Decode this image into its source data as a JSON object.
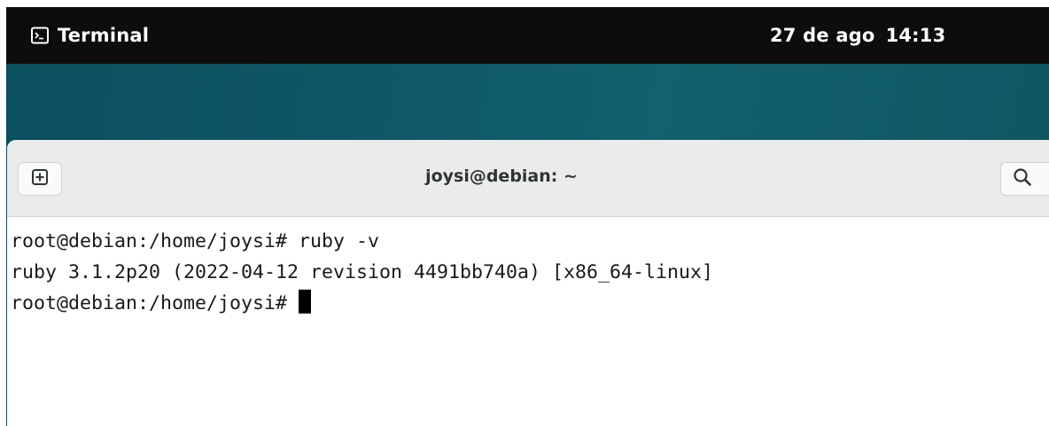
{
  "topbar": {
    "app_name": "Terminal",
    "app_icon": "terminal-icon",
    "date": "27 de ago",
    "time": "14:13"
  },
  "window": {
    "title": "joysi@debian: ~",
    "new_tab_icon": "new-tab-icon",
    "search_icon": "search-icon"
  },
  "terminal": {
    "lines": [
      "root@debian:/home/joysi# ruby -v",
      "ruby 3.1.2p20 (2022-04-12 revision 4491bb740a) [x86_64-linux]",
      "root@debian:/home/joysi# "
    ]
  },
  "colors": {
    "topbar_bg": "#0d0d0d",
    "desktop_bg": "#0f5766",
    "headerbar_bg": "#ebebea",
    "terminal_bg": "#ffffff",
    "terminal_fg": "#1a1a1a"
  }
}
